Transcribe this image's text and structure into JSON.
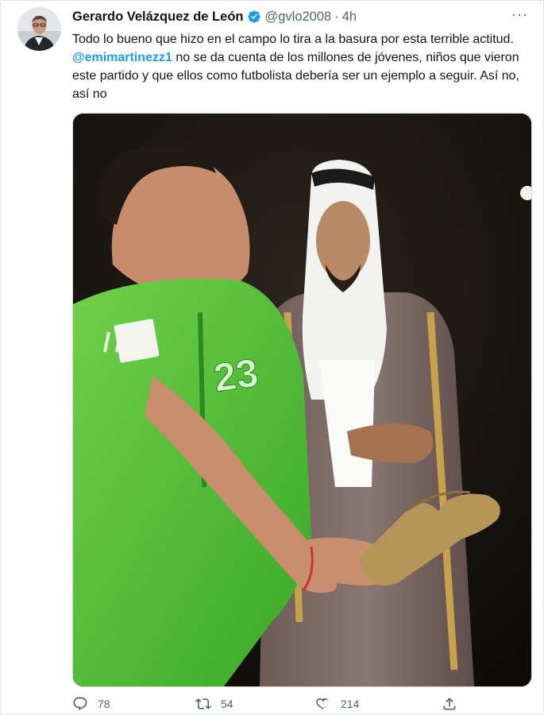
{
  "tweet": {
    "author_name": "Gerardo Velázquez de León",
    "handle": "@gvlo2008",
    "separator": "·",
    "time": "4h",
    "more_label": "···",
    "text_part1": "Todo lo bueno que hizo en el campo lo tira a la basura por esta terrible actitud. ",
    "mention": "@emimartinezz1",
    "text_part2": " no se da cuenta de los millones de jóvenes, niños que vieron este partido y que ellos como futbolista debería ser un ejemplo a seguir. Así no, así no",
    "jersey_number": "23"
  },
  "actions": {
    "replies": "78",
    "retweets": "54",
    "likes": "214"
  },
  "icons": [
    "verified-badge-icon",
    "more-icon",
    "reply-icon",
    "retweet-icon",
    "like-icon",
    "share-icon"
  ],
  "colors": {
    "accent": "#1d9bf0",
    "muted": "#536471",
    "text": "#0f1419"
  }
}
